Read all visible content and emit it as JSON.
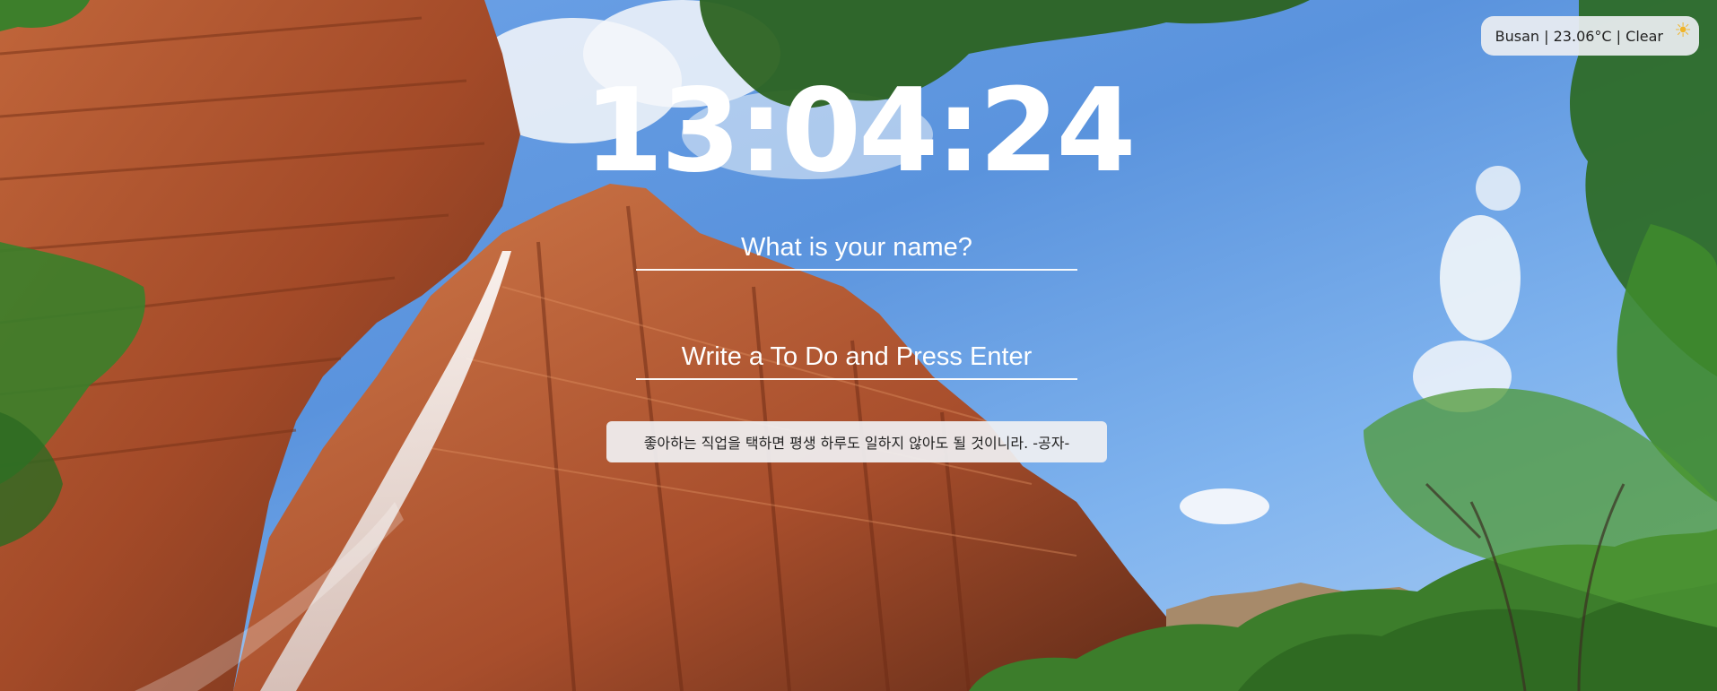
{
  "weather": {
    "text": "Busan | 23.06°C | Clear",
    "icon": "sun-icon"
  },
  "clock": {
    "time": "13:04:24"
  },
  "name_input": {
    "placeholder": "What is your name?",
    "value": ""
  },
  "todo_input": {
    "placeholder": "Write a To Do and Press Enter",
    "value": ""
  },
  "quote": {
    "text": "좋아하는 직업을 택하면 평생 하루도 일하지 않아도 될 것이니라. -공자-"
  },
  "colors": {
    "sky": "#5a93dd",
    "rock": "#b0522d",
    "foliage": "#3f7d2a",
    "text": "#ffffff"
  }
}
